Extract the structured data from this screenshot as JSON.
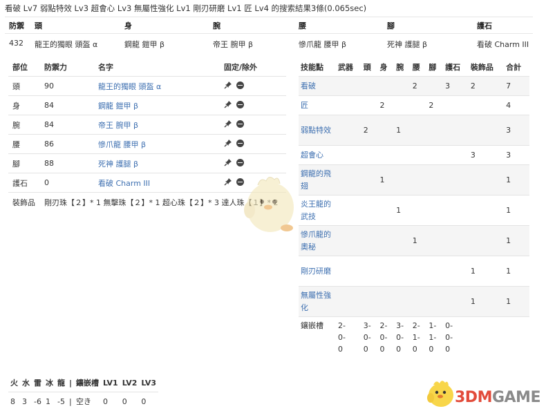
{
  "summary": "看破 Lv7 弱點特效 Lv3 超會心 Lv3 無屬性強化 Lv1 剛刃研磨 Lv1 匠 Lv4 的搜索結果3條(0.065sec)",
  "overview": {
    "headers": [
      "防禦",
      "頭",
      "身",
      "腕",
      "腰",
      "腳",
      "護石"
    ],
    "values": [
      "432",
      "龍王的獨眼 頭盔 α",
      "鋼龍 鎧甲 β",
      "帝王 腕甲 β",
      "慘爪龍 腰甲 β",
      "死神 護腿 β",
      "看破 Charm III"
    ]
  },
  "equipment": {
    "headers": [
      "部位",
      "防禦力",
      "名字",
      "固定/除外"
    ],
    "rows": [
      {
        "part": "頭",
        "def": "90",
        "name": "龍王的獨眼 頭盔 α"
      },
      {
        "part": "身",
        "def": "84",
        "name": "鋼龍 鎧甲 β"
      },
      {
        "part": "腕",
        "def": "84",
        "name": "帝王 腕甲 β"
      },
      {
        "part": "腰",
        "def": "86",
        "name": "慘爪龍 腰甲 β"
      },
      {
        "part": "腳",
        "def": "88",
        "name": "死神 護腿 β"
      },
      {
        "part": "護石",
        "def": "0",
        "name": "看破 Charm III"
      }
    ],
    "decorations_label": "裝飾品",
    "decorations": "剛刃珠【２】* 1 無擊珠【２】* 1 超心珠【２】* 3 達人珠【１】* 2"
  },
  "skills": {
    "headers": [
      "技能點",
      "武器",
      "頭",
      "身",
      "腕",
      "腰",
      "腳",
      "護石",
      "裝飾品",
      "合計"
    ],
    "rows": [
      {
        "name": "看破",
        "cells": [
          "",
          "",
          "",
          "",
          "2",
          "",
          "3",
          "2",
          "7"
        ]
      },
      {
        "name": "匠",
        "cells": [
          "",
          "",
          "2",
          "",
          "",
          "2",
          "",
          "",
          "4"
        ]
      },
      {
        "name": "弱點特效",
        "cells": [
          "",
          "2",
          "",
          "1",
          "",
          "",
          "",
          "",
          "3"
        ]
      },
      {
        "name": "超會心",
        "cells": [
          "",
          "",
          "",
          "",
          "",
          "",
          "",
          "3",
          "3"
        ]
      },
      {
        "name": "鋼龍的飛翅",
        "cells": [
          "",
          "",
          "1",
          "",
          "",
          "",
          "",
          "",
          "1"
        ]
      },
      {
        "name": "炎王龍的武技",
        "cells": [
          "",
          "",
          "",
          "1",
          "",
          "",
          "",
          "",
          "1"
        ]
      },
      {
        "name": "慘爪龍的奧秘",
        "cells": [
          "",
          "",
          "",
          "",
          "1",
          "",
          "",
          "",
          "1"
        ]
      },
      {
        "name": "剛刃研磨",
        "cells": [
          "",
          "",
          "",
          "",
          "",
          "",
          "",
          "1",
          "1"
        ]
      },
      {
        "name": "無屬性強化",
        "cells": [
          "",
          "",
          "",
          "",
          "",
          "",
          "",
          "1",
          "1"
        ]
      }
    ],
    "slots_label": "鑲嵌槽",
    "slots": [
      "",
      "2-0-0",
      "3-0-0",
      "2-0-0",
      "3-0-0",
      "2-1-0",
      "1-1-0",
      "0-0-0",
      "",
      ""
    ]
  },
  "resist": {
    "headers": [
      "火",
      "水",
      "雷",
      "冰",
      "龍",
      "|",
      "鑲嵌槽",
      "LV1",
      "LV2",
      "LV3"
    ],
    "values": [
      "8",
      "3",
      "-6",
      "1",
      "-5",
      "|",
      "空き",
      "0",
      "0",
      "0"
    ]
  },
  "watermark": {
    "brand": "3DM",
    "suffix": "GAME"
  }
}
